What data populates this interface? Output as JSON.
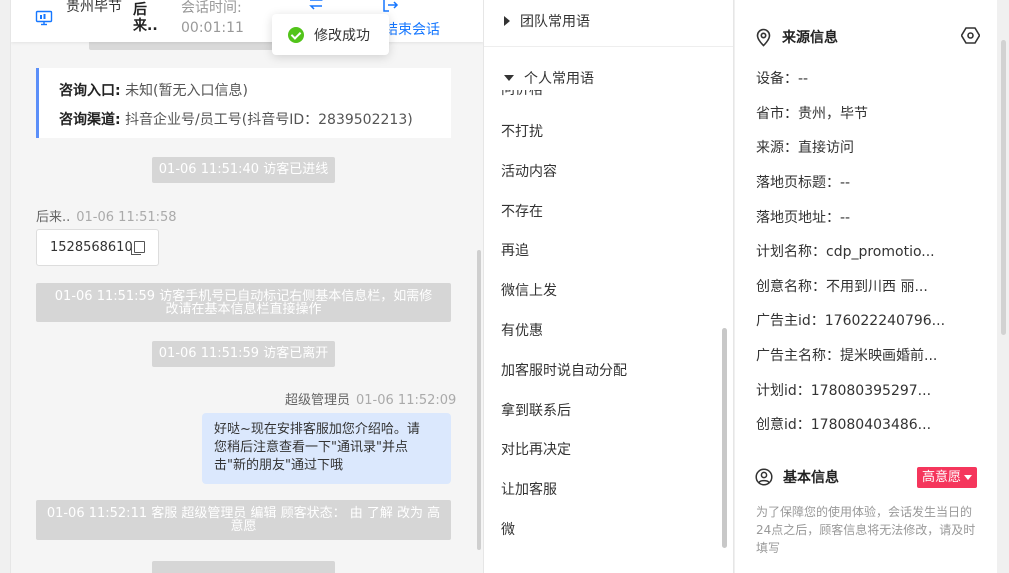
{
  "header": {
    "location": "贵州毕节",
    "visitor_name": "后来..",
    "session_time_label": "会话时间:",
    "session_time": "00:01:11",
    "end_session_label": "结束会话"
  },
  "toast": {
    "text": "修改成功"
  },
  "chat": {
    "info_card": {
      "entry_label": "咨询入口:",
      "entry_value": "未知(暂无入口信息)",
      "channel_label": "咨询渠道:",
      "channel_value": "抖音企业号/员工号(抖音号ID：2839502213)"
    },
    "system_entered": "01-06 11:51:40 访客已进线",
    "visitor_sender": "后来..",
    "visitor_time": "01-06 11:51:58",
    "visitor_message": "15285686101",
    "system_phone_line1": "01-06 11:51:59 访客手机号已自动标记右侧基本信息栏，如需修",
    "system_phone_line2": "改请在基本信息栏直接操作",
    "system_left": "01-06 11:51:59 访客已离开",
    "agent_sender": "超级管理员",
    "agent_time": "01-06 11:52:09",
    "agent_line1": "好哒~现在安排客服加您介绍哈。请",
    "agent_line2": "您稍后注意查看一下\"通讯录\"并点",
    "agent_line3": "击\"新的朋友\"通过下哦",
    "system_edit_line1": "01-06 11:52:11 客服 超级管理员 编辑 顾客状态： 由 了解 改为 高",
    "system_edit_line2": "意愿"
  },
  "phrases": {
    "team_group": "团队常用语",
    "personal_group": "个人常用语",
    "partial_item": "问价格",
    "items": [
      "不打扰",
      "活动内容",
      "不存在",
      "再追",
      "微信上发",
      "有优惠",
      "加客服时说自动分配",
      "拿到联系后",
      "对比再决定",
      "让加客服",
      "微"
    ]
  },
  "source": {
    "title": "来源信息",
    "rows": [
      "设备：--",
      "省市：贵州，毕节",
      "来源：直接访问",
      "落地页标题：--",
      "落地页地址：--",
      "计划名称：cdp_promotio...",
      "创意名称：不用到川西 丽...",
      "广告主id：176022240796...",
      "广告主名称：提米映画婚前...",
      "计划id：178080395297...",
      "创意id：178080403486..."
    ],
    "basic_title": "基本信息",
    "intent_badge": "高意愿",
    "notice": "为了保障您的使用体验，会话发生当日的24点之后，顾客信息将无法修改，请及时填写"
  },
  "colors": {
    "accent": "#1677ff",
    "success": "#52c41a",
    "badge": "#f5365c",
    "bubble": "#dbe8fd"
  },
  "icons": [
    "monitor-icon",
    "transfer-icon",
    "exit-icon",
    "check-circle-icon",
    "copy-icon",
    "location-pin-icon",
    "settings-hex-icon",
    "user-circle-icon",
    "caret-right-icon",
    "caret-down-icon"
  ]
}
